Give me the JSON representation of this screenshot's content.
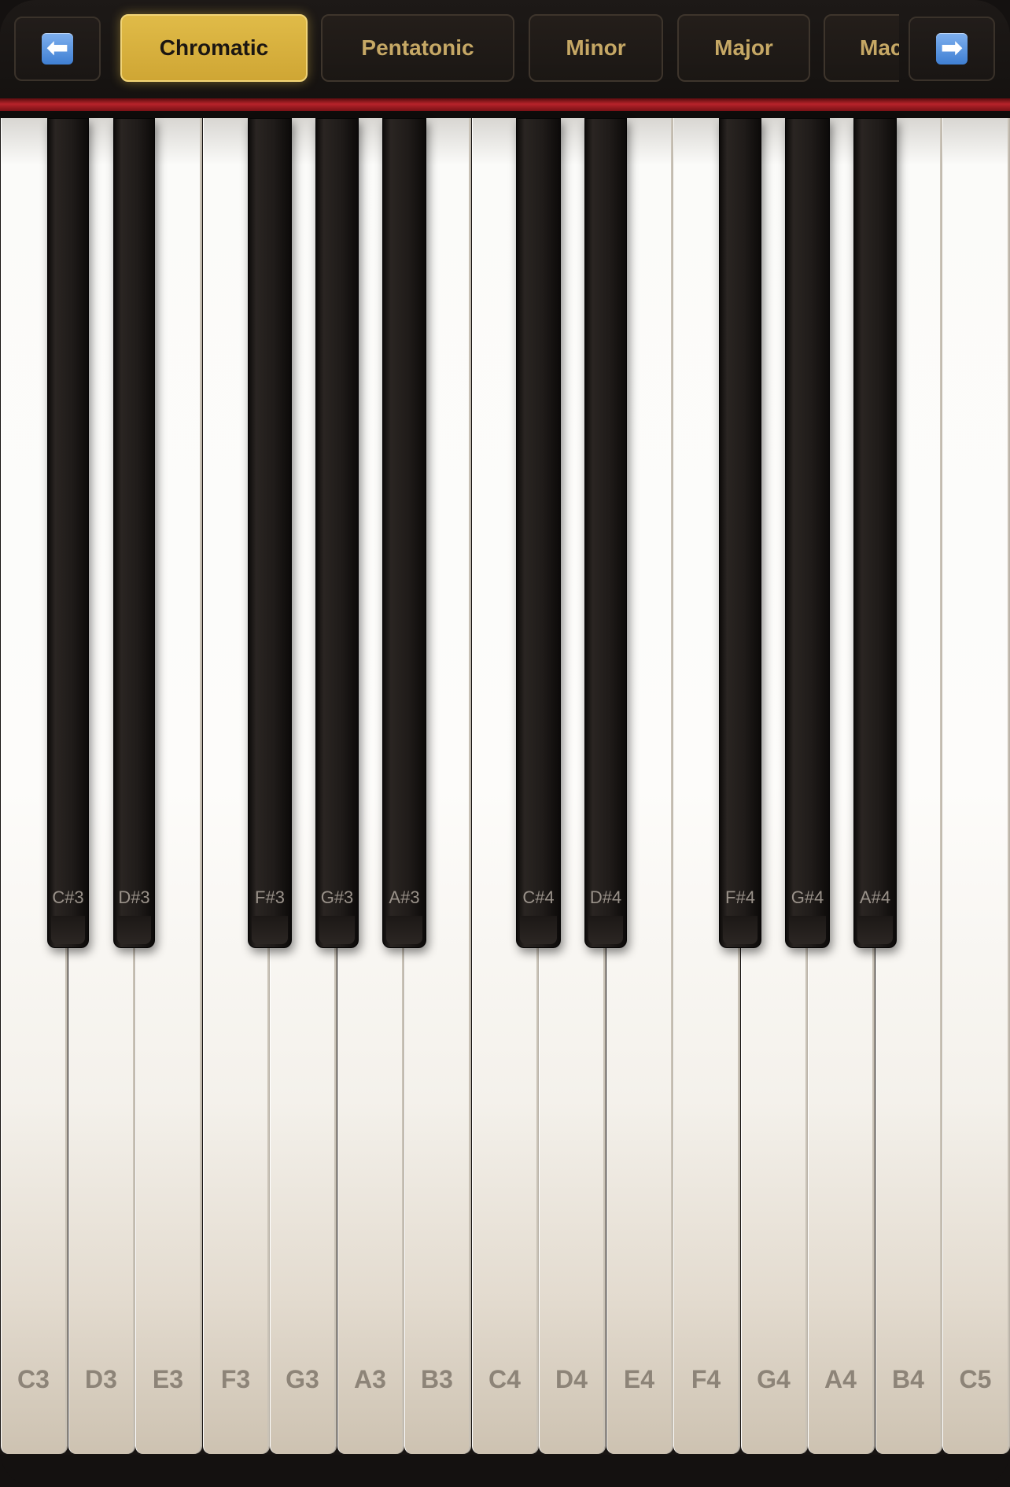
{
  "nav": {
    "prev_icon": "left-arrow-icon",
    "prev_glyph": "⬅",
    "next_icon": "right-arrow-icon",
    "next_glyph": "➡"
  },
  "scales": [
    {
      "label": "Chromatic",
      "active": true
    },
    {
      "label": "Pentatonic",
      "active": false
    },
    {
      "label": "Minor",
      "active": false
    },
    {
      "label": "Major",
      "active": false
    },
    {
      "label": "Mac",
      "active": false
    }
  ],
  "white_keys": [
    "C3",
    "D3",
    "E3",
    "F3",
    "G3",
    "A3",
    "B3",
    "C4",
    "D4",
    "E4",
    "F4",
    "G4",
    "A4",
    "B4",
    "C5"
  ],
  "black_keys": [
    "C#3",
    "D#3",
    "F#3",
    "G#3",
    "A#3",
    "C#4",
    "D#4",
    "F#4",
    "G#4",
    "A#4"
  ],
  "colors": {
    "accent_gold": "#d9b33f",
    "scale_text": "#c6a865",
    "felt_red": "#b7232a",
    "background": "#181412"
  }
}
